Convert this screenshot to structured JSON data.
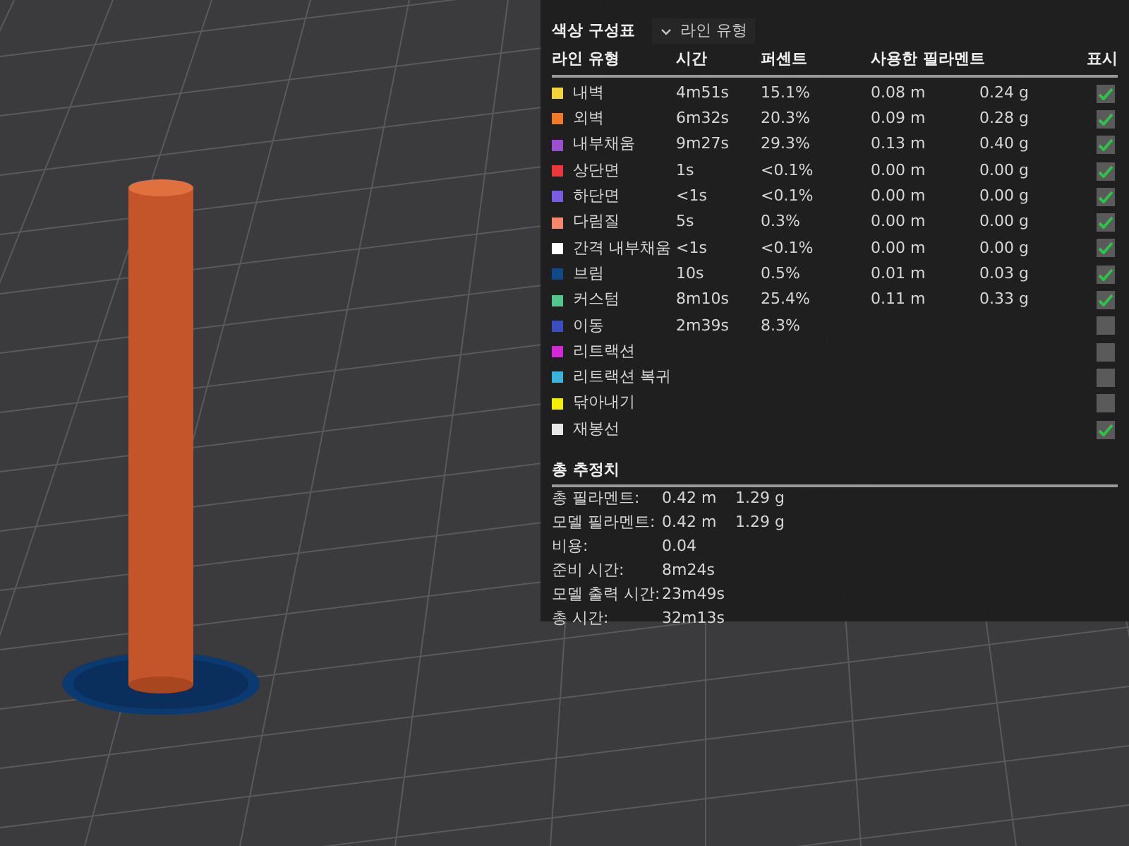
{
  "color_scheme": {
    "label": "색상 구성표",
    "value": "라인 유형"
  },
  "table": {
    "columns": [
      "라인 유형",
      "시간",
      "퍼센트",
      "사용한 필라멘트",
      "표시"
    ],
    "rows": [
      {
        "name": "내벽",
        "color": "#f2d43a",
        "time": "4m51s",
        "percent": "15.1%",
        "length": "0.08 m",
        "weight": "0.24 g",
        "checked": true
      },
      {
        "name": "외벽",
        "color": "#f07a2a",
        "time": "6m32s",
        "percent": "20.3%",
        "length": "0.09 m",
        "weight": "0.28 g",
        "checked": true
      },
      {
        "name": "내부채움",
        "color": "#9b4fd0",
        "time": "9m27s",
        "percent": "29.3%",
        "length": "0.13 m",
        "weight": "0.40 g",
        "checked": true
      },
      {
        "name": "상단면",
        "color": "#e8383a",
        "time": "1s",
        "percent": "<0.1%",
        "length": "0.00 m",
        "weight": "0.00 g",
        "checked": true
      },
      {
        "name": "하단면",
        "color": "#7a5ce0",
        "time": "<1s",
        "percent": "<0.1%",
        "length": "0.00 m",
        "weight": "0.00 g",
        "checked": true
      },
      {
        "name": "다림질",
        "color": "#f5876a",
        "time": "5s",
        "percent": "0.3%",
        "length": "0.00 m",
        "weight": "0.00 g",
        "checked": true
      },
      {
        "name": "간격 내부채움",
        "color": "#ffffff",
        "time": "<1s",
        "percent": "<0.1%",
        "length": "0.00 m",
        "weight": "0.00 g",
        "checked": true
      },
      {
        "name": "브림",
        "color": "#0d4a8a",
        "time": "10s",
        "percent": "0.5%",
        "length": "0.01 m",
        "weight": "0.03 g",
        "checked": true
      },
      {
        "name": "커스텀",
        "color": "#4fc88a",
        "time": "8m10s",
        "percent": "25.4%",
        "length": "0.11 m",
        "weight": "0.33 g",
        "checked": true
      },
      {
        "name": "이동",
        "color": "#3a4ec0",
        "time": "2m39s",
        "percent": "8.3%",
        "checked": false
      },
      {
        "name": "리트랙션",
        "color": "#d02ad8",
        "checked": false
      },
      {
        "name": "리트랙션 복귀",
        "color": "#3ab4d8",
        "checked": false
      },
      {
        "name": "닦아내기",
        "color": "#f0f000",
        "checked": false
      },
      {
        "name": "재봉선",
        "color": "#e8e8e8",
        "checked": true
      }
    ]
  },
  "summary": {
    "title": "총 추정치",
    "rows": [
      {
        "label": "총 필라멘트:",
        "values": [
          "0.42 m",
          "1.29 g"
        ]
      },
      {
        "label": "모델 필라멘트:",
        "values": [
          "0.42 m",
          "1.29 g"
        ]
      },
      {
        "label": "비용:",
        "values": [
          "0.04"
        ]
      },
      {
        "label": "준비 시간:",
        "values": [
          "8m24s"
        ]
      },
      {
        "label": "모델 출력 시간:",
        "values": [
          "23m49s"
        ]
      },
      {
        "label": "총 시간:",
        "values": [
          "32m13s"
        ]
      }
    ]
  }
}
